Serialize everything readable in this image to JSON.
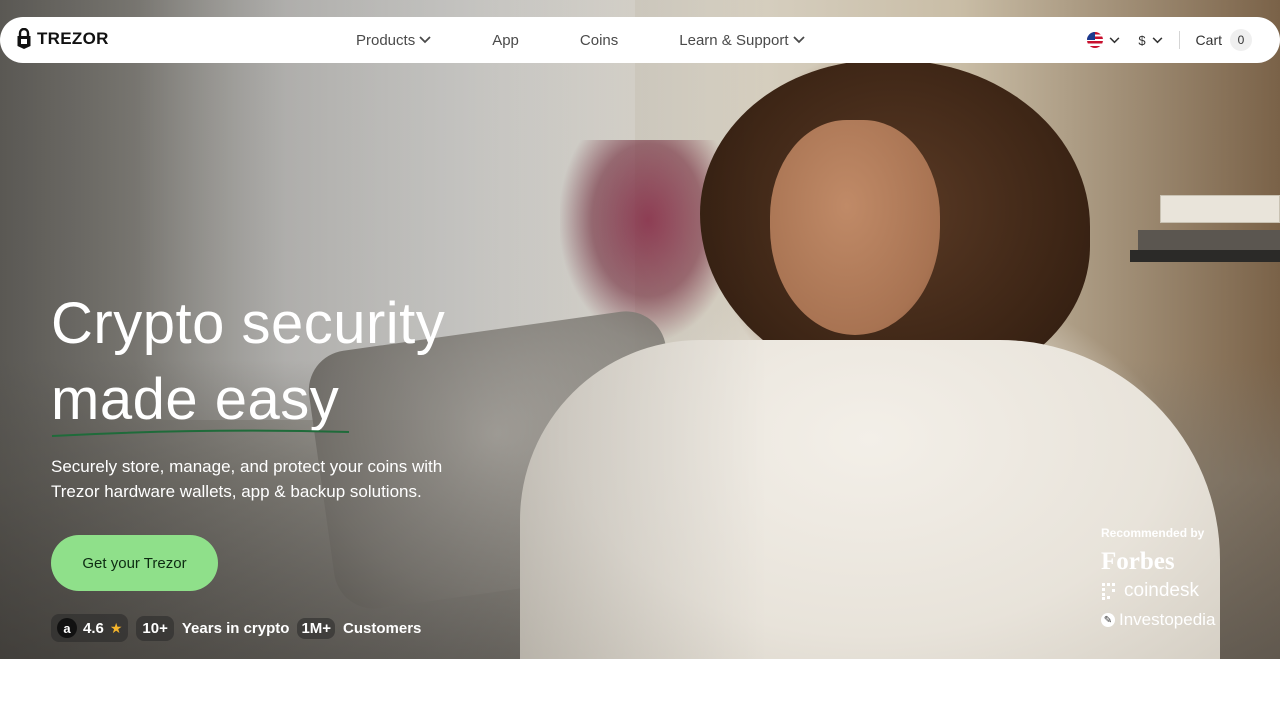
{
  "nav": {
    "logo_text": "TREZOR",
    "links": [
      "Products",
      "App",
      "Coins",
      "Learn & Support"
    ],
    "currency": "$",
    "cart_label": "Cart",
    "cart_count": "0"
  },
  "hero": {
    "headline_line1": "Crypto security",
    "headline_line2": "made easy",
    "subtext_line1": "Securely store, manage, and protect your coins with",
    "subtext_line2": "Trezor hardware wallets, app & backup solutions.",
    "cta_label": "Get your Trezor",
    "rating": "4.6",
    "years_value": "10+",
    "years_label": "Years in crypto",
    "customers_value": "1M+",
    "customers_label": "Customers"
  },
  "recommended": {
    "title": "Recommended by",
    "brands": [
      "Forbes",
      "coindesk",
      "Investopedia"
    ]
  },
  "colors": {
    "cta_bg": "#8fe08a",
    "underline": "#1f6b3a",
    "star": "#f5b52b"
  }
}
